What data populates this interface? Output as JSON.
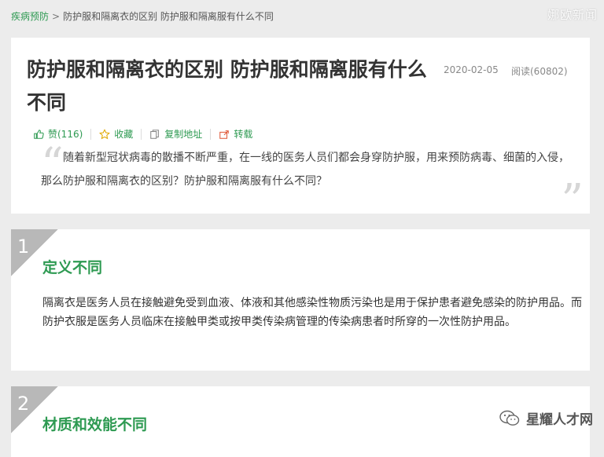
{
  "breadcrumb": {
    "category": "疾病预防",
    "separator": ">",
    "current": "防护服和隔离衣的区别 防护服和隔离服有什么不同"
  },
  "watermark_top": "娜欧新闻",
  "article": {
    "title": "防护服和隔离衣的区别 防护服和隔离服有什么不同",
    "date": "2020-02-05",
    "views": "阅读(60802)",
    "actions": {
      "like": "赞(116)",
      "favorite": "收藏",
      "copy": "复制地址",
      "share": "转载"
    },
    "quote_open": "“",
    "quote_close": "”",
    "summary": "随着新型冠状病毒的散播不断严重，在一线的医务人员们都会身穿防护服，用来预防病毒、细菌的入侵，那么防护服和隔离衣的区别？防护服和隔离服有什么不同？"
  },
  "sections": [
    {
      "number": "1",
      "heading": "定义不同",
      "body": "隔离衣是医务人员在接触避免受到血液、体液和其他感染性物质污染也是用于保护患者避免感染的防护用品。而防护衣服是医务人员临床在接触甲类或按甲类传染病管理的传染病患者时所穿的一次性防护用品。"
    },
    {
      "number": "2",
      "heading": "材质和效能不同"
    }
  ],
  "watermark_brand": "星耀人才网",
  "colors": {
    "accent": "#2e9a52",
    "background": "#ececec",
    "number_badge": "#b8b8b8"
  },
  "icons": {
    "like": "thumbs-up-icon",
    "favorite": "star-icon",
    "copy": "copy-icon",
    "share": "share-icon",
    "brand": "wechat-icon"
  }
}
